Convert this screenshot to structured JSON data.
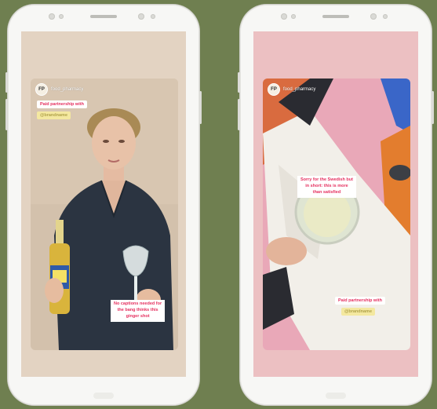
{
  "phones": [
    {
      "story": {
        "username": "food_pharmacy",
        "avatar_label": "FP",
        "tags": [
          "Paid partnership with",
          "@brandname"
        ],
        "caption_lines": [
          "No captions needed for",
          "the bang thinks this",
          "ginger shot"
        ]
      }
    },
    {
      "story": {
        "username": "food_pharmacy",
        "avatar_label": "FP",
        "caption_lines": [
          "Sorry for the Swedish but",
          "in short: this is more",
          "than satisfied"
        ],
        "tags": [
          "Paid partnership with",
          "@brandname"
        ]
      }
    }
  ]
}
